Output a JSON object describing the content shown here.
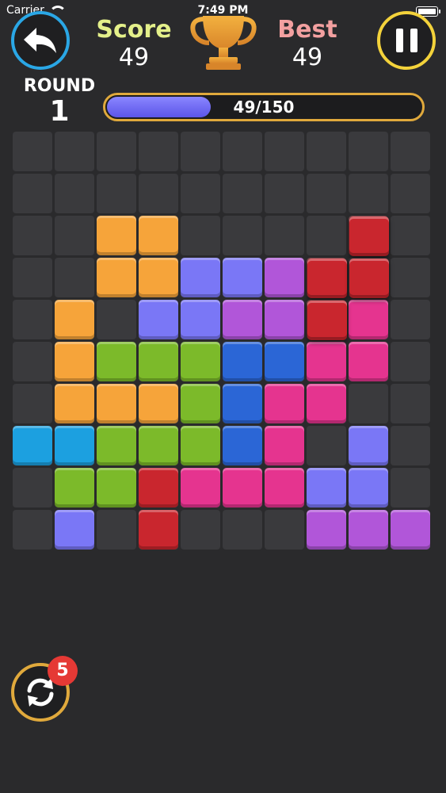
{
  "status_bar": {
    "carrier": "Carrier",
    "time": "7:49 PM"
  },
  "header": {
    "score_label": "Score",
    "score_value": "49",
    "best_label": "Best",
    "best_value": "49"
  },
  "round": {
    "label": "ROUND",
    "value": "1"
  },
  "progress": {
    "text": "49/150",
    "current": 49,
    "total": 150
  },
  "icons": {
    "back": "back-arrow-icon",
    "trophy": "trophy-icon",
    "pause": "pause-icon",
    "refresh": "refresh-icon"
  },
  "refresh_badge": "5",
  "colors": {
    "orange": "#f6a43a",
    "blue": "#7a77f6",
    "purple": "#b156d9",
    "green": "#7cba2a",
    "darkblue": "#2b66d6",
    "pink": "#e5348f",
    "cyan": "#1ca0e0",
    "red": "#c9262e"
  },
  "board": {
    "rows": 10,
    "cols": 10,
    "cells": [
      [
        2,
        2,
        "orange"
      ],
      [
        2,
        3,
        "orange"
      ],
      [
        2,
        8,
        "red-ghost"
      ],
      [
        3,
        2,
        "orange"
      ],
      [
        3,
        3,
        "orange"
      ],
      [
        3,
        4,
        "blue"
      ],
      [
        3,
        5,
        "blue"
      ],
      [
        3,
        6,
        "purple"
      ],
      [
        3,
        7,
        "red-ghost"
      ],
      [
        4,
        1,
        "orange"
      ],
      [
        4,
        3,
        "blue"
      ],
      [
        4,
        4,
        "blue"
      ],
      [
        4,
        5,
        "purple"
      ],
      [
        4,
        6,
        "purple"
      ],
      [
        4,
        7,
        "red-ghost"
      ],
      [
        4,
        8,
        "pink"
      ],
      [
        5,
        1,
        "orange"
      ],
      [
        5,
        2,
        "green"
      ],
      [
        5,
        3,
        "green"
      ],
      [
        5,
        4,
        "green"
      ],
      [
        5,
        5,
        "darkblue"
      ],
      [
        5,
        6,
        "darkblue"
      ],
      [
        5,
        7,
        "pink"
      ],
      [
        5,
        8,
        "pink"
      ],
      [
        6,
        1,
        "orange"
      ],
      [
        6,
        2,
        "orange"
      ],
      [
        6,
        3,
        "orange"
      ],
      [
        6,
        4,
        "green"
      ],
      [
        6,
        5,
        "darkblue"
      ],
      [
        6,
        6,
        "pink"
      ],
      [
        6,
        7,
        "pink"
      ],
      [
        7,
        0,
        "cyan"
      ],
      [
        7,
        1,
        "cyan"
      ],
      [
        7,
        2,
        "green"
      ],
      [
        7,
        3,
        "green"
      ],
      [
        7,
        4,
        "green"
      ],
      [
        7,
        5,
        "darkblue"
      ],
      [
        7,
        6,
        "pink"
      ],
      [
        7,
        8,
        "blue"
      ],
      [
        8,
        1,
        "green"
      ],
      [
        8,
        2,
        "green"
      ],
      [
        8,
        3,
        "red"
      ],
      [
        8,
        4,
        "pink"
      ],
      [
        8,
        5,
        "pink"
      ],
      [
        8,
        6,
        "pink"
      ],
      [
        8,
        7,
        "blue"
      ],
      [
        8,
        8,
        "blue"
      ],
      [
        9,
        1,
        "blue"
      ],
      [
        9,
        3,
        "red"
      ],
      [
        9,
        7,
        "purple"
      ],
      [
        9,
        8,
        "purple"
      ],
      [
        9,
        9,
        "purple"
      ]
    ],
    "falling_piece": {
      "color": "red",
      "cells": [
        [
          2.5,
          8.5
        ],
        [
          3.5,
          7.5
        ],
        [
          3.5,
          8.5
        ],
        [
          4.5,
          7.5
        ]
      ]
    }
  }
}
